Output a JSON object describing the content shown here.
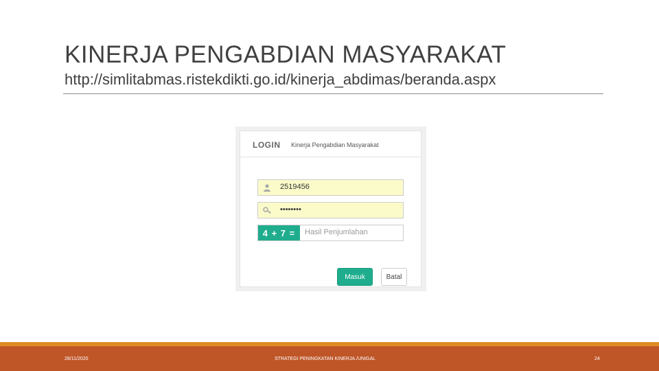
{
  "slide": {
    "title": "KINERJA PENGABDIAN MASYARAKAT",
    "url": "http://simlitabmas.ristekdikti.go.id/kinerja_abdimas/beranda.aspx"
  },
  "login": {
    "heading": "LOGIN",
    "subheading": "Kinerja Pengabdian Masyarakat",
    "username_value": "2519456",
    "password_value": "••••••••",
    "captcha_question": "4 + 7 =",
    "captcha_placeholder": "Hasil Penjumlahan",
    "submit_label": "Masuk",
    "cancel_label": "Batal",
    "icons": {
      "username": "user-icon",
      "password": "key-icon"
    }
  },
  "footer": {
    "date": "28/11/2020",
    "center_text": "STRATEGI PENINGKATAN KINERJA./UNIGAL",
    "page_number": "24"
  },
  "colors": {
    "accent": "#1fad8e",
    "autofill": "#fafbc9",
    "footer_band": "#bf5628",
    "footer_stripe": "#e08a24",
    "text": "#404040"
  }
}
